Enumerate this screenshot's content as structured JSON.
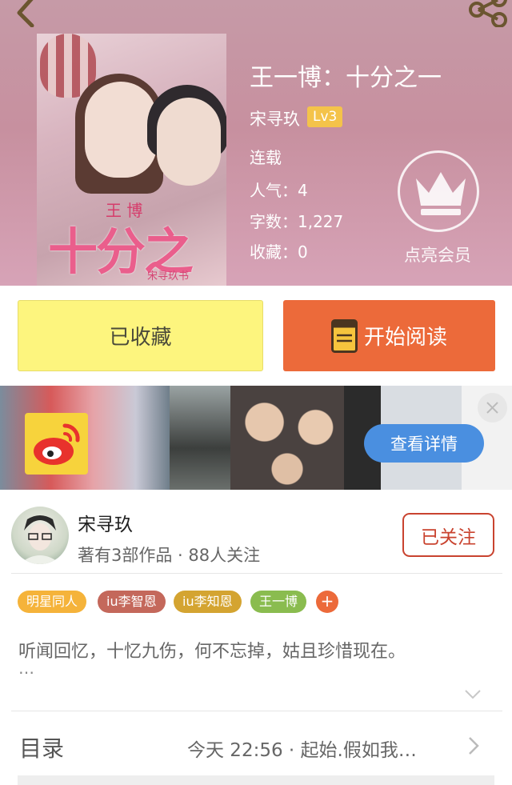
{
  "header": {
    "back_icon": "chevron-left-icon",
    "share_icon": "share-icon"
  },
  "book": {
    "title": "王一博：十分之一",
    "author": "宋寻玖",
    "level": "Lv3",
    "status": "连载",
    "popularity": "人气：4",
    "word_count": "字数：1,227",
    "favorites": "收藏：0",
    "cover": {
      "title": "十分之一",
      "small": "王  博",
      "author": "宋寻玖书"
    }
  },
  "vip": {
    "icon": "crown-icon",
    "label": "点亮会员"
  },
  "actions": {
    "collect_label": "已收藏",
    "read_label": "开始阅读",
    "read_icon": "book-icon"
  },
  "ad": {
    "logo": "weibo-icon",
    "detail_label": "查看详情",
    "close_icon": "close-icon"
  },
  "writer": {
    "name": "宋寻玖",
    "stats": "著有3部作品 · 88人关注",
    "follow_label": "已关注"
  },
  "tags": [
    {
      "label": "明星同人",
      "color": "#f5b33a"
    },
    {
      "label": "iu李智恩",
      "color": "#c4685b"
    },
    {
      "label": "iu李知恩",
      "color": "#d4a431"
    },
    {
      "label": "王一博",
      "color": "#8abc4f"
    }
  ],
  "tag_add_label": "+",
  "synopsis": {
    "text": "听闻回忆，十忆九伤，何不忘掉，姑且珍惜现在。",
    "ellipsis": "…"
  },
  "toc": {
    "label": "目录",
    "latest": "今天 22:56 · 起始.假如我…"
  },
  "colors": {
    "accent_orange": "#ec6a3a",
    "collect_yellow": "#fdf57e",
    "follow_red": "#c9432f",
    "level_gold": "#f4c34a"
  }
}
